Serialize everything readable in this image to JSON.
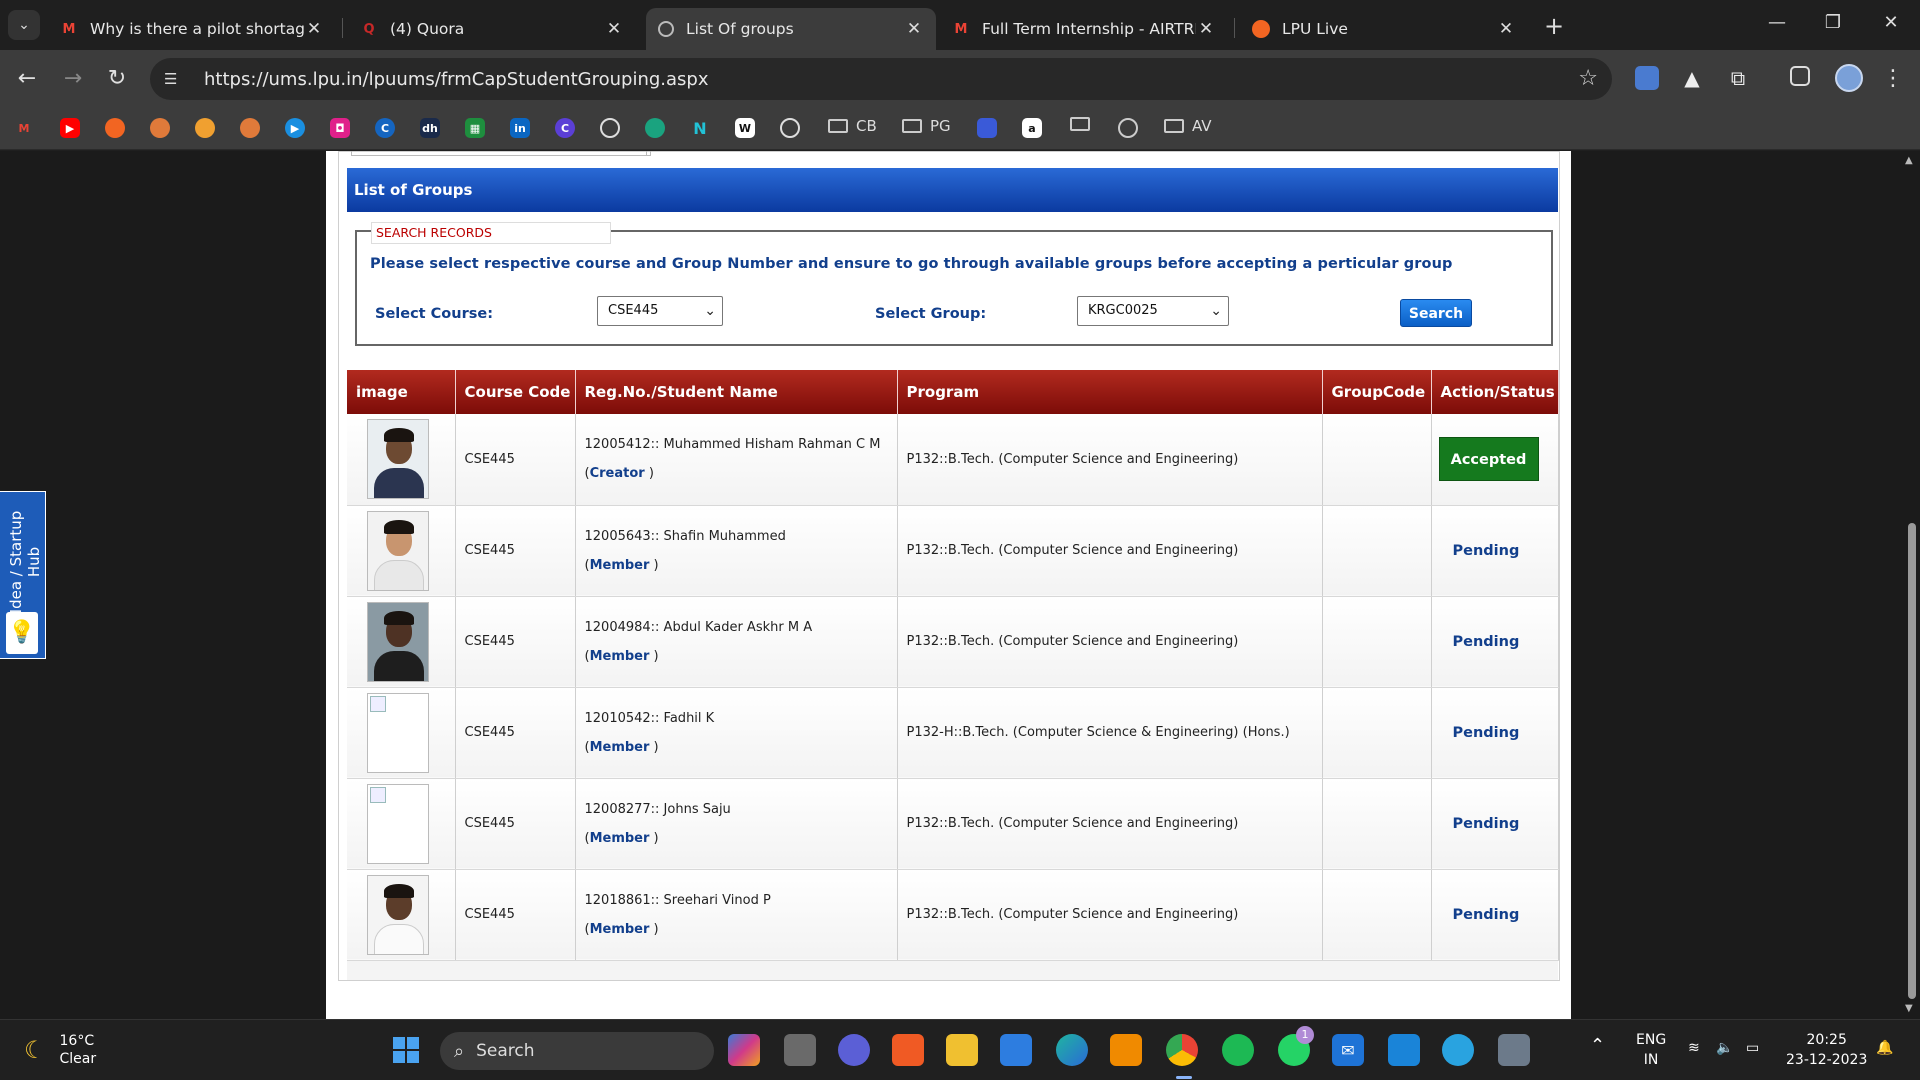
{
  "browser": {
    "tabs": [
      {
        "title": "Why is there a pilot shortage wi",
        "active": false,
        "icon": "gmail-icon"
      },
      {
        "title": "(4) Quora",
        "active": false,
        "icon": "quora-icon"
      },
      {
        "title": "List Of groups",
        "active": true,
        "icon": "globe-icon"
      },
      {
        "title": "Full Term Internship - AIRTRIBE",
        "active": false,
        "icon": "gmail-icon"
      },
      {
        "title": "LPU Live",
        "active": false,
        "icon": "lpu-icon"
      }
    ],
    "url": "https://ums.lpu.in/lpuums/frmCapStudentGrouping.aspx",
    "bookmark_folders": [
      "CB",
      "PG",
      "AV"
    ]
  },
  "page": {
    "heading": "List of Groups",
    "search": {
      "legend": "SEARCH RECORDS",
      "instruction": "Please select respective course and Group Number and ensure to go through available groups before accepting a perticular group",
      "course_label": "Select Course:",
      "course_value": "CSE445",
      "group_label": "Select Group:",
      "group_value": "KRGC0025",
      "button": "Search"
    },
    "table": {
      "headers": [
        "image",
        "Course Code",
        "Reg.No./Student Name",
        "Program",
        "GroupCode",
        "Action/Status"
      ],
      "rows": [
        {
          "course": "CSE445",
          "student": "12005412:: Muhammed Hisham Rahman C M",
          "role": "Creator",
          "program": "P132::B.Tech. (Computer Science and Engineering)",
          "group_code": "",
          "status": "Accepted",
          "photo": "present"
        },
        {
          "course": "CSE445",
          "student": "12005643:: Shafin Muhammed",
          "role": "Member",
          "program": "P132::B.Tech. (Computer Science and Engineering)",
          "group_code": "",
          "status": "Pending",
          "photo": "present"
        },
        {
          "course": "CSE445",
          "student": "12004984:: Abdul Kader Askhr M A",
          "role": "Member",
          "program": "P132::B.Tech. (Computer Science and Engineering)",
          "group_code": "",
          "status": "Pending",
          "photo": "present"
        },
        {
          "course": "CSE445",
          "student": "12010542:: Fadhil K",
          "role": "Member",
          "program": "P132-H::B.Tech. (Computer Science & Engineering) (Hons.)",
          "group_code": "",
          "status": "Pending",
          "photo": "broken"
        },
        {
          "course": "CSE445",
          "student": "12008277:: Johns Saju",
          "role": "Member",
          "program": "P132::B.Tech. (Computer Science and Engineering)",
          "group_code": "",
          "status": "Pending",
          "photo": "broken"
        },
        {
          "course": "CSE445",
          "student": "12018861:: Sreehari Vinod P",
          "role": "Member",
          "program": "P132::B.Tech. (Computer Science and Engineering)",
          "group_code": "",
          "status": "Pending",
          "photo": "present"
        }
      ]
    },
    "side_tab": "Idea / Startup Hub"
  },
  "taskbar": {
    "temperature": "16°C",
    "weather": "Clear",
    "search": "Search",
    "language": "ENG",
    "region": "IN",
    "time": "20:25",
    "date": "23-12-2023",
    "whatsapp_badge": "1"
  },
  "colors": {
    "heading_blue": "#0b3aa0",
    "header_red": "#8e1610",
    "accepted_green": "#157a1e",
    "link_blue": "#123f8c"
  }
}
